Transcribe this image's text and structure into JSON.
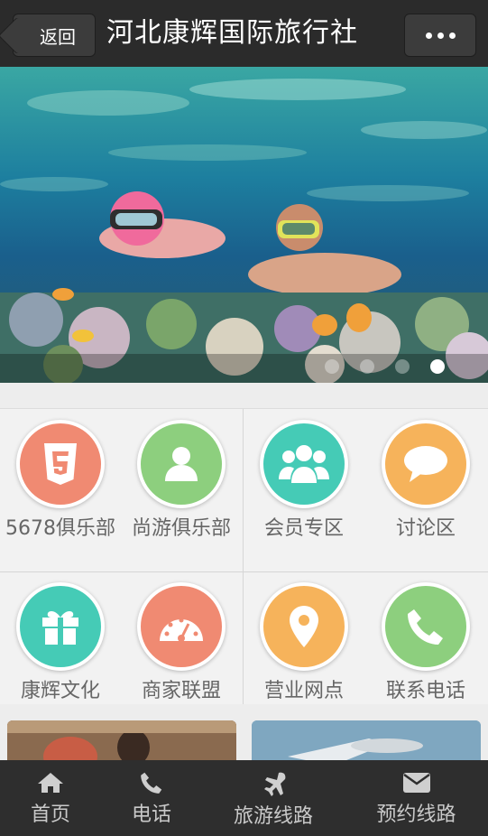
{
  "topbar": {
    "back_label": "返回",
    "title": "河北康辉国际旅行社"
  },
  "banner": {
    "slides": 4,
    "active_slide": 4
  },
  "grid": [
    {
      "label": "5678俱乐部",
      "icon": "html5-icon",
      "color": "#f08a72"
    },
    {
      "label": "尚游俱乐部",
      "icon": "user-icon",
      "color": "#8dcf7e"
    },
    {
      "label": "会员专区",
      "icon": "group-icon",
      "color": "#45cbb6"
    },
    {
      "label": "讨论区",
      "icon": "comment-icon",
      "color": "#f6b35b"
    },
    {
      "label": "康辉文化",
      "icon": "gift-icon",
      "color": "#45cbb6"
    },
    {
      "label": "商家联盟",
      "icon": "dashboard-icon",
      "color": "#f08a72"
    },
    {
      "label": "营业网点",
      "icon": "map-marker-icon",
      "color": "#f6b35b"
    },
    {
      "label": "联系电话",
      "icon": "phone-icon",
      "color": "#8dcf7e"
    }
  ],
  "footer": [
    {
      "label": "首页",
      "icon": "home-icon"
    },
    {
      "label": "电话",
      "icon": "phone-icon"
    },
    {
      "label": "旅游线路",
      "icon": "plane-icon"
    },
    {
      "label": "预约线路",
      "icon": "envelope-icon"
    }
  ]
}
